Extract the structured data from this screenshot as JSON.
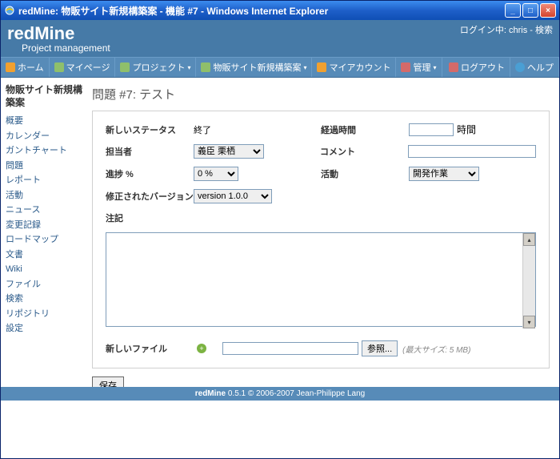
{
  "window": {
    "title": "redMine: 物販サイト新規構築案 - 機能 #7 - Windows Internet Explorer"
  },
  "header": {
    "logo": "redMine",
    "subtitle": "Project management",
    "login_prefix": "ログイン中: ",
    "user": "chris",
    "search_link": "検索"
  },
  "menu": {
    "home": "ホーム",
    "mypage": "マイページ",
    "projects": "プロジェクト",
    "subproject": "物販サイト新規構築案",
    "myaccount": "マイアカウント",
    "admin": "管理",
    "logout": "ログアウト",
    "help": "ヘルプ"
  },
  "sidebar": {
    "title": "物販サイト新規構築案",
    "items": [
      "概要",
      "カレンダー",
      "ガントチャート",
      "問題",
      "レポート",
      "活動",
      "ニュース",
      "変更記録",
      "ロードマップ",
      "文書",
      "Wiki",
      "ファイル",
      "検索",
      "リポジトリ",
      "設定"
    ]
  },
  "issue": {
    "heading": "問題 #7: テスト",
    "labels": {
      "status": "新しいステータス",
      "status_value": "終了",
      "assignee": "担当者",
      "progress": "進捗 %",
      "fixed_version": "修正されたバージョン",
      "notes": "注記",
      "elapsed": "経過時間",
      "hours_unit": "時間",
      "comment": "コメント",
      "activity": "活動",
      "newfile": "新しいファイル",
      "browse": "参照...",
      "maxsize": "(最大サイズ: 5 MB)",
      "save": "保存"
    },
    "assignee_options": [
      "義臣 栗栖"
    ],
    "assignee_selected": "義臣 栗栖",
    "progress_options": [
      "0 %"
    ],
    "progress_selected": "0 %",
    "version_options": [
      "version 1.0.0"
    ],
    "version_selected": "version 1.0.0",
    "activity_options": [
      "開発作業"
    ],
    "activity_selected": "開発作業",
    "elapsed_value": "",
    "comment_value": "",
    "notes_value": "",
    "file_value": ""
  },
  "footer": {
    "app": "redMine",
    "rest": " 0.5.1 © 2006-2007 Jean-Philippe Lang"
  }
}
